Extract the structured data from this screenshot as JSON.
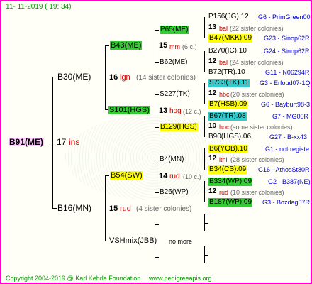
{
  "header": {
    "date": "11- 11-2019 ( 19: 34)"
  },
  "root": {
    "name": "B91(ME)",
    "number": "17",
    "suffix": "ins"
  },
  "father": {
    "name": "B30(ME)",
    "number": "16",
    "suffix": "lgn",
    "sisters": "(14 sister colonies)"
  },
  "mother": {
    "name": "B16(MN)",
    "number": "15",
    "suffix": "rud",
    "sisters": "(4 sister colonies)"
  },
  "b43": {
    "name": "B43(ME)",
    "number": "15",
    "suffix": "mm",
    "sisters": "(6 c.)"
  },
  "s101": {
    "name": "S101(HGS)",
    "number": "13",
    "suffix": "hog",
    "sisters": "(12 c.)"
  },
  "b54": {
    "name": "B54(SW)",
    "number": "14",
    "suffix": "rud",
    "sisters": "(10 c.)"
  },
  "vsh": {
    "name": "VSHmix(JBB)",
    "more": "no more"
  },
  "p65": {
    "name": "P65(ME)"
  },
  "b62": {
    "name": "B62(ME)"
  },
  "s227": {
    "name": "S227(TK)"
  },
  "b129": {
    "name": "B129(HGS)"
  },
  "b4": {
    "name": "B4(MN)"
  },
  "b26": {
    "name": "B26(WP)"
  },
  "gen4": [
    {
      "name": "P156(JG).12",
      "gen": "G6 - PrimGreen00"
    },
    {
      "number": "13",
      "suffix": "bal",
      "sisters": "(22 sister colonies)"
    },
    {
      "name": "B47(MKK).09",
      "gen": "G23 - Sinop62R"
    },
    {
      "name": "B270(IC).10",
      "gen": "G24 - Sinop62R"
    },
    {
      "number": "12",
      "suffix": "bal",
      "sisters": "(24 sister colonies)"
    },
    {
      "name": "B72(TR).10",
      "gen": "G11 - N06294R"
    },
    {
      "name": "S733(TK).11",
      "gen": "G3 - Erfoud07-1Q"
    },
    {
      "number": "12",
      "suffix": "hbc",
      "sisters": "(20 sister colonies)"
    },
    {
      "name": "B7(HSB).09",
      "gen": "G6 - Bayburt98-3"
    },
    {
      "name": "B67(TR).08",
      "gen": "G7 - MG00R"
    },
    {
      "number": "10",
      "suffix": "hoc",
      "sisters": "(some sister colonies)"
    },
    {
      "name": "B90(HGS).06",
      "gen": "G27 - B-xx43"
    },
    {
      "name": "B6(YOB).10",
      "gen": "G1 - not registe"
    },
    {
      "number": "12",
      "suffix": "lthl",
      "sisters": "(28 sister colonies)"
    },
    {
      "name": "B34(CS).09",
      "gen": "G16 - AthosSt80R"
    },
    {
      "name": "B334(WP).09",
      "gen": "G2 - B387(NE)"
    },
    {
      "number": "12",
      "suffix": "rud",
      "sisters": "(10 sister colonies)"
    },
    {
      "name": "B187(WP).09",
      "gen": "G3 - Bozdag07R"
    }
  ],
  "footer": {
    "copyright": "Copyright 2004-2019 @ Karl Kehrle Foundation",
    "url": "www.pedigreeapis.org"
  },
  "colors": {
    "frame": "#ff00cc",
    "green": "#33cc33",
    "yellow": "#ffff00",
    "cyan": "#33cccc",
    "magenta_fill": "#ffccff"
  }
}
